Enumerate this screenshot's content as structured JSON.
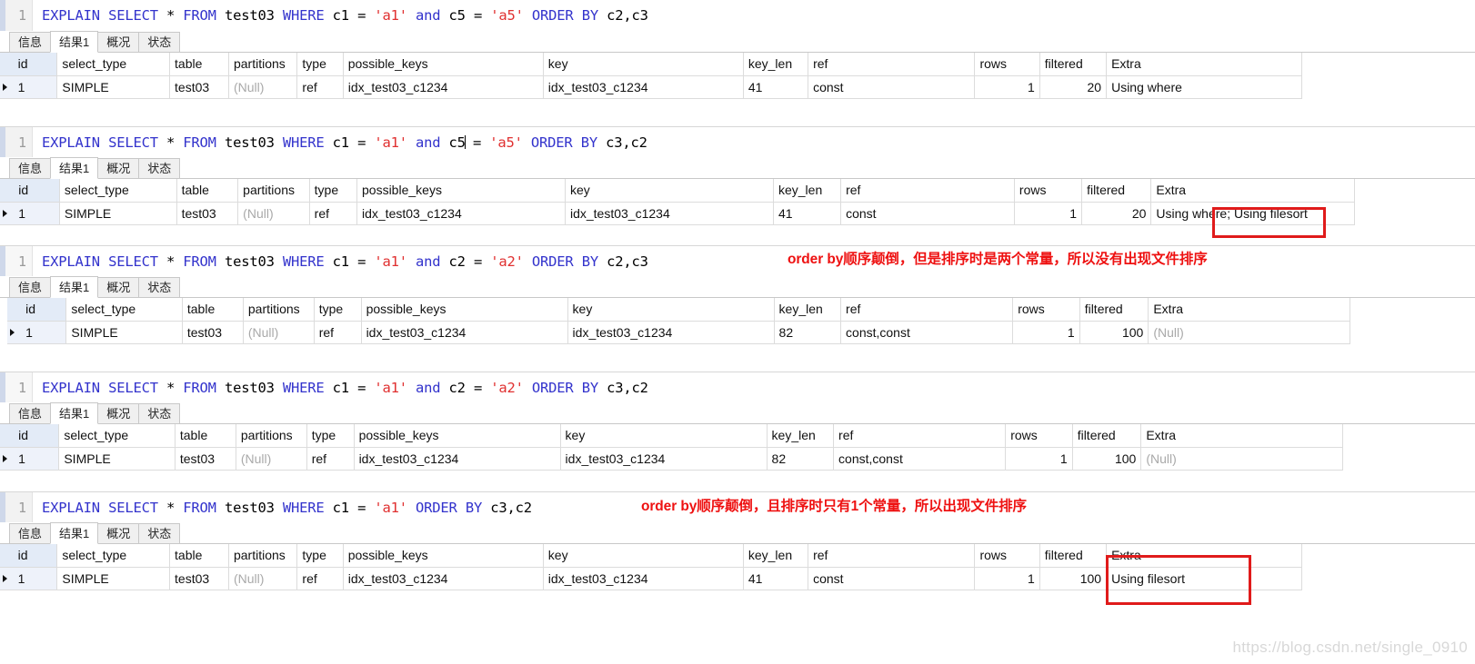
{
  "tabs": [
    "信息",
    "结果1",
    "概况",
    "状态"
  ],
  "active_tab": "结果1",
  "columns": [
    "id",
    "select_type",
    "table",
    "partitions",
    "type",
    "possible_keys",
    "key",
    "key_len",
    "ref",
    "rows",
    "filtered",
    "Extra"
  ],
  "blocks": [
    {
      "line_no": "1",
      "sql": {
        "parts": [
          {
            "t": "EXPLAIN",
            "c": "kw"
          },
          {
            "t": " ",
            "c": "idn"
          },
          {
            "t": "SELECT",
            "c": "kw"
          },
          {
            "t": " * ",
            "c": "idn"
          },
          {
            "t": "FROM",
            "c": "kw"
          },
          {
            "t": " test03 ",
            "c": "idn"
          },
          {
            "t": "WHERE",
            "c": "kw"
          },
          {
            "t": " c1 = ",
            "c": "idn"
          },
          {
            "t": "'a1'",
            "c": "str"
          },
          {
            "t": " ",
            "c": "idn"
          },
          {
            "t": "and",
            "c": "kw"
          },
          {
            "t": " c5 = ",
            "c": "idn"
          },
          {
            "t": "'a5'",
            "c": "str"
          },
          {
            "t": " ",
            "c": "idn"
          },
          {
            "t": "ORDER",
            "c": "kw"
          },
          {
            "t": " ",
            "c": "idn"
          },
          {
            "t": "BY",
            "c": "kw"
          },
          {
            "t": " c2,c3",
            "c": "idn"
          }
        ]
      },
      "row": {
        "id": "1",
        "select_type": "SIMPLE",
        "table": "test03",
        "partitions": "(Null)",
        "type": "ref",
        "possible_keys": "idx_test03_c1234",
        "key": "idx_test03_c1234",
        "key_len": "41",
        "ref": "const",
        "rows": "1",
        "filtered": "20",
        "Extra": "Using where"
      },
      "partitions_null": true,
      "extra_null": false,
      "annotation": null
    },
    {
      "line_no": "1",
      "sql": {
        "parts": [
          {
            "t": "EXPLAIN",
            "c": "kw"
          },
          {
            "t": " ",
            "c": "idn"
          },
          {
            "t": "SELECT",
            "c": "kw"
          },
          {
            "t": " * ",
            "c": "idn"
          },
          {
            "t": "FROM",
            "c": "kw"
          },
          {
            "t": " test03 ",
            "c": "idn"
          },
          {
            "t": "WHERE",
            "c": "kw"
          },
          {
            "t": " c1 = ",
            "c": "idn"
          },
          {
            "t": "'a1'",
            "c": "str"
          },
          {
            "t": " ",
            "c": "idn"
          },
          {
            "t": "and",
            "c": "kw"
          },
          {
            "t": " c5",
            "c": "idn"
          },
          {
            "t": "|",
            "c": "caret"
          },
          {
            "t": " = ",
            "c": "idn"
          },
          {
            "t": "'a5'",
            "c": "str"
          },
          {
            "t": " ",
            "c": "idn"
          },
          {
            "t": "ORDER",
            "c": "kw"
          },
          {
            "t": " ",
            "c": "idn"
          },
          {
            "t": "BY",
            "c": "kw"
          },
          {
            "t": " c3,c2",
            "c": "idn"
          }
        ]
      },
      "row": {
        "id": "1",
        "select_type": "SIMPLE",
        "table": "test03",
        "partitions": "(Null)",
        "type": "ref",
        "possible_keys": "idx_test03_c1234",
        "key": "idx_test03_c1234",
        "key_len": "41",
        "ref": "const",
        "rows": "1",
        "filtered": "20",
        "Extra": "Using where; Using filesort"
      },
      "partitions_null": true,
      "extra_null": false,
      "annotation": null
    },
    {
      "line_no": "1",
      "sql": {
        "parts": [
          {
            "t": "EXPLAIN",
            "c": "kw"
          },
          {
            "t": " ",
            "c": "idn"
          },
          {
            "t": "SELECT",
            "c": "kw"
          },
          {
            "t": " * ",
            "c": "idn"
          },
          {
            "t": "FROM",
            "c": "kw"
          },
          {
            "t": " test03 ",
            "c": "idn"
          },
          {
            "t": "WHERE",
            "c": "kw"
          },
          {
            "t": " c1 = ",
            "c": "idn"
          },
          {
            "t": "'a1'",
            "c": "str"
          },
          {
            "t": " ",
            "c": "idn"
          },
          {
            "t": "and",
            "c": "kw"
          },
          {
            "t": " c2 = ",
            "c": "idn"
          },
          {
            "t": "'a2'",
            "c": "str"
          },
          {
            "t": " ",
            "c": "idn"
          },
          {
            "t": "ORDER",
            "c": "kw"
          },
          {
            "t": " ",
            "c": "idn"
          },
          {
            "t": "BY",
            "c": "kw"
          },
          {
            "t": " c2,c3",
            "c": "idn"
          }
        ]
      },
      "row": {
        "id": "1",
        "select_type": "SIMPLE",
        "table": "test03",
        "partitions": "(Null)",
        "type": "ref",
        "possible_keys": "idx_test03_c1234",
        "key": "idx_test03_c1234",
        "key_len": "82",
        "ref": "const,const",
        "rows": "1",
        "filtered": "100",
        "Extra": "(Null)"
      },
      "partitions_null": true,
      "extra_null": true,
      "annotation": "order by顺序颠倒，但是排序时是两个常量，所以没有出现文件排序"
    },
    {
      "line_no": "1",
      "sql": {
        "parts": [
          {
            "t": "EXPLAIN",
            "c": "kw"
          },
          {
            "t": " ",
            "c": "idn"
          },
          {
            "t": "SELECT",
            "c": "kw"
          },
          {
            "t": " * ",
            "c": "idn"
          },
          {
            "t": "FROM",
            "c": "kw"
          },
          {
            "t": " test03 ",
            "c": "idn"
          },
          {
            "t": "WHERE",
            "c": "kw"
          },
          {
            "t": " c1 = ",
            "c": "idn"
          },
          {
            "t": "'a1'",
            "c": "str"
          },
          {
            "t": " ",
            "c": "idn"
          },
          {
            "t": "and",
            "c": "kw"
          },
          {
            "t": " c2 = ",
            "c": "idn"
          },
          {
            "t": "'a2'",
            "c": "str"
          },
          {
            "t": " ",
            "c": "idn"
          },
          {
            "t": "ORDER",
            "c": "kw"
          },
          {
            "t": " ",
            "c": "idn"
          },
          {
            "t": "BY",
            "c": "kw"
          },
          {
            "t": " c3,c2",
            "c": "idn"
          }
        ]
      },
      "row": {
        "id": "1",
        "select_type": "SIMPLE",
        "table": "test03",
        "partitions": "(Null)",
        "type": "ref",
        "possible_keys": "idx_test03_c1234",
        "key": "idx_test03_c1234",
        "key_len": "82",
        "ref": "const,const",
        "rows": "1",
        "filtered": "100",
        "Extra": "(Null)"
      },
      "partitions_null": true,
      "extra_null": true,
      "annotation": null
    },
    {
      "line_no": "1",
      "sql": {
        "parts": [
          {
            "t": "EXPLAIN",
            "c": "kw"
          },
          {
            "t": " ",
            "c": "idn"
          },
          {
            "t": "SELECT",
            "c": "kw"
          },
          {
            "t": " * ",
            "c": "idn"
          },
          {
            "t": "FROM",
            "c": "kw"
          },
          {
            "t": " test03 ",
            "c": "idn"
          },
          {
            "t": "WHERE",
            "c": "kw"
          },
          {
            "t": " c1 = ",
            "c": "idn"
          },
          {
            "t": "'a1'",
            "c": "str"
          },
          {
            "t": " ",
            "c": "idn"
          },
          {
            "t": "ORDER",
            "c": "kw"
          },
          {
            "t": " ",
            "c": "idn"
          },
          {
            "t": "BY",
            "c": "kw"
          },
          {
            "t": " c3,c2",
            "c": "idn"
          }
        ]
      },
      "row": {
        "id": "1",
        "select_type": "SIMPLE",
        "table": "test03",
        "partitions": "(Null)",
        "type": "ref",
        "possible_keys": "idx_test03_c1234",
        "key": "idx_test03_c1234",
        "key_len": "41",
        "ref": "const",
        "rows": "1",
        "filtered": "100",
        "Extra": "Using filesort"
      },
      "partitions_null": true,
      "extra_null": false,
      "annotation": "order by顺序颠倒，且排序时只有1个常量，所以出现文件排序"
    }
  ],
  "highlight_color": "#e01b1b",
  "watermark": "https://blog.csdn.net/single_0910"
}
